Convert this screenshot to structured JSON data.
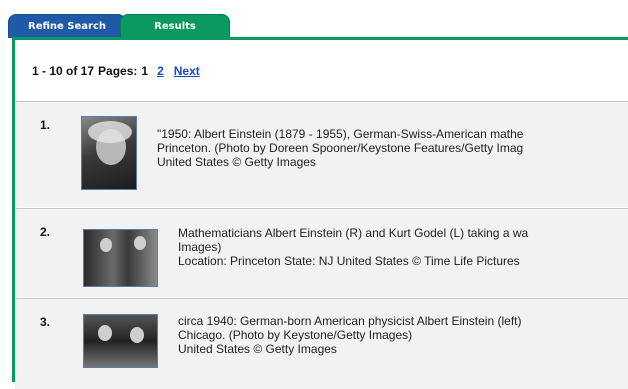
{
  "tabs": {
    "refine": "Refine Search",
    "results": "Results"
  },
  "pager": {
    "range": "1 - 10 of 17",
    "pages_label": "Pages:",
    "current_page": "1",
    "page_2": "2",
    "next": "Next"
  },
  "results": [
    {
      "number": "1.",
      "lines": [
        "\"1950: Albert Einstein (1879 - 1955), German-Swiss-American mathe",
        "Princeton. (Photo by Doreen Spooner/Keystone Features/Getty Imag",
        "United States © Getty Images"
      ]
    },
    {
      "number": "2.",
      "lines": [
        "Mathematicians Albert Einstein (R) and Kurt Godel (L) taking a wa",
        "Images)",
        "Location: Princeton  State: NJ United States © Time Life Pictures"
      ]
    },
    {
      "number": "3.",
      "lines": [
        "circa 1940: German-born American physicist Albert Einstein (left)",
        "Chicago. (Photo by Keystone/Getty Images)",
        "United States © Getty Images"
      ]
    }
  ],
  "colors": {
    "tab_blue": "#1e5aa8",
    "tab_green": "#0c9960",
    "link": "#1a49c8",
    "row_bg": "#f2f2f2"
  }
}
